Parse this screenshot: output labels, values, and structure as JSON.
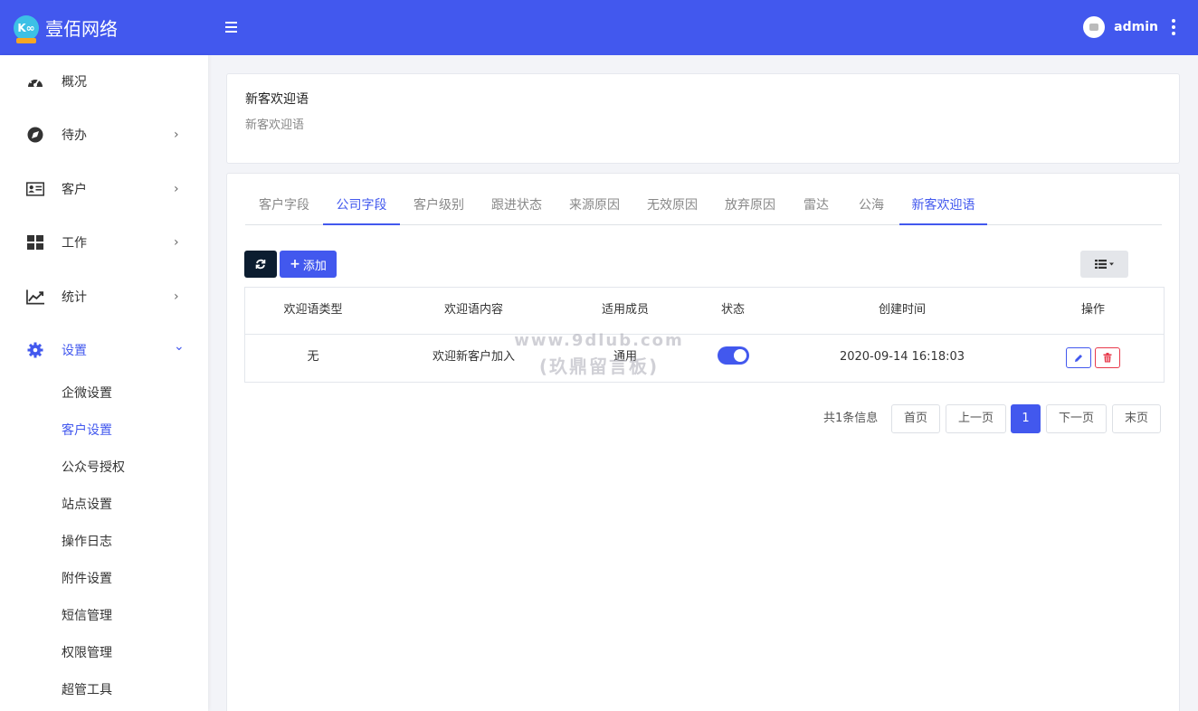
{
  "brand": {
    "name": "壹佰网络",
    "logo_text": "K∞"
  },
  "topbar": {
    "username": "admin"
  },
  "sidebar": {
    "items": [
      {
        "label": "概况",
        "icon": "dashboard-icon"
      },
      {
        "label": "待办",
        "icon": "compass-icon",
        "chevron": "›"
      },
      {
        "label": "客户",
        "icon": "id-card-icon",
        "chevron": "›"
      },
      {
        "label": "工作",
        "icon": "grid-icon",
        "chevron": "›"
      },
      {
        "label": "统计",
        "icon": "chart-line-icon",
        "chevron": "›"
      },
      {
        "label": "设置",
        "icon": "gear-icon",
        "chevron": "⌄"
      }
    ],
    "sub_items": [
      "企微设置",
      "客户设置",
      "公众号授权",
      "站点设置",
      "操作日志",
      "附件设置",
      "短信管理",
      "权限管理",
      "超管工具"
    ]
  },
  "page_header": {
    "title": "新客欢迎语",
    "subtitle": "新客欢迎语"
  },
  "tabs": [
    "客户字段",
    "公司字段",
    "客户级别",
    "跟进状态",
    "来源原因",
    "无效原因",
    "放弃原因",
    "雷达",
    "公海",
    "新客欢迎语"
  ],
  "toolbar": {
    "add_label": "添加"
  },
  "table": {
    "columns": [
      "欢迎语类型",
      "欢迎语内容",
      "适用成员",
      "状态",
      "创建时间",
      "操作"
    ],
    "rows": [
      {
        "type": "无",
        "content": "欢迎新客户加入",
        "members": "通用",
        "status": true,
        "created": "2020-09-14 16:18:03"
      }
    ]
  },
  "pagination": {
    "info": "共1条信息",
    "first": "首页",
    "prev": "上一页",
    "current": "1",
    "next": "下一页",
    "last": "末页"
  },
  "watermark": {
    "line1": "www.9dlub.com",
    "line2": "(玖鼎留言板)"
  },
  "colors": {
    "primary": "#4258ee",
    "dark_button": "#0c1d30",
    "danger": "#e8394b"
  }
}
